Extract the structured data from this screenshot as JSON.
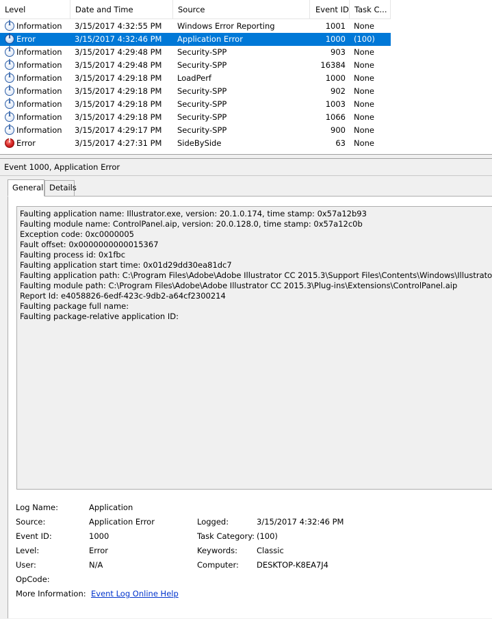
{
  "grid": {
    "columns": [
      "Level",
      "Date and Time",
      "Source",
      "Event ID",
      "Task C..."
    ],
    "rows": [
      {
        "level": "Information",
        "icon": "info-icon",
        "date": "3/15/2017 4:32:55 PM",
        "source": "Windows Error Reporting",
        "event_id": "1001",
        "task": "None"
      },
      {
        "level": "Error",
        "icon": "error-icon",
        "date": "3/15/2017 4:32:46 PM",
        "source": "Application Error",
        "event_id": "1000",
        "task": "(100)",
        "selected": true
      },
      {
        "level": "Information",
        "icon": "info-icon",
        "date": "3/15/2017 4:29:48 PM",
        "source": "Security-SPP",
        "event_id": "903",
        "task": "None"
      },
      {
        "level": "Information",
        "icon": "info-icon",
        "date": "3/15/2017 4:29:48 PM",
        "source": "Security-SPP",
        "event_id": "16384",
        "task": "None"
      },
      {
        "level": "Information",
        "icon": "info-icon",
        "date": "3/15/2017 4:29:18 PM",
        "source": "LoadPerf",
        "event_id": "1000",
        "task": "None"
      },
      {
        "level": "Information",
        "icon": "info-icon",
        "date": "3/15/2017 4:29:18 PM",
        "source": "Security-SPP",
        "event_id": "902",
        "task": "None"
      },
      {
        "level": "Information",
        "icon": "info-icon",
        "date": "3/15/2017 4:29:18 PM",
        "source": "Security-SPP",
        "event_id": "1003",
        "task": "None"
      },
      {
        "level": "Information",
        "icon": "info-icon",
        "date": "3/15/2017 4:29:18 PM",
        "source": "Security-SPP",
        "event_id": "1066",
        "task": "None"
      },
      {
        "level": "Information",
        "icon": "info-icon",
        "date": "3/15/2017 4:29:17 PM",
        "source": "Security-SPP",
        "event_id": "900",
        "task": "None"
      },
      {
        "level": "Error",
        "icon": "error-icon",
        "date": "3/15/2017 4:27:31 PM",
        "source": "SideBySide",
        "event_id": "63",
        "task": "None"
      }
    ]
  },
  "detail": {
    "title": "Event 1000, Application Error",
    "tabs": [
      "General",
      "Details"
    ],
    "description": [
      "Faulting application name: Illustrator.exe, version: 20.1.0.174, time stamp: 0x57a12b93",
      "Faulting module name: ControlPanel.aip, version: 20.0.128.0, time stamp: 0x57a12c0b",
      "Exception code: 0xc0000005",
      "Fault offset: 0x0000000000015367",
      "Faulting process id: 0x1fbc",
      "Faulting application start time: 0x01d29dd30ea81dc7",
      "Faulting application path: C:\\Program Files\\Adobe\\Adobe Illustrator CC 2015.3\\Support Files\\Contents\\Windows\\Illustrator.exe",
      "Faulting module path: C:\\Program Files\\Adobe\\Adobe Illustrator CC 2015.3\\Plug-ins\\Extensions\\ControlPanel.aip",
      "Report Id: e4058826-6edf-423c-9db2-a64cf2300214",
      "Faulting package full name: ",
      "Faulting package-relative application ID: "
    ],
    "props": {
      "log_name_label": "Log Name:",
      "log_name": "Application",
      "source_label": "Source:",
      "source": "Application Error",
      "logged_label": "Logged:",
      "logged": "3/15/2017 4:32:46 PM",
      "event_id_label": "Event ID:",
      "event_id": "1000",
      "task_category_label": "Task Category:",
      "task_category": "(100)",
      "level_label": "Level:",
      "level": "Error",
      "keywords_label": "Keywords:",
      "keywords": "Classic",
      "user_label": "User:",
      "user": "N/A",
      "computer_label": "Computer:",
      "computer": "DESKTOP-K8EA7J4",
      "opcode_label": "OpCode:",
      "more_info_label": "More Information:",
      "more_info_link": "Event Log Online Help"
    }
  },
  "colors": {
    "selection": "#0078d7",
    "link": "#0033cc"
  }
}
